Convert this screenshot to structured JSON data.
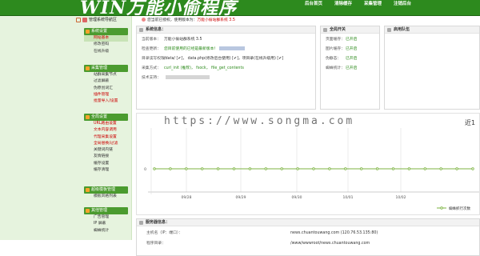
{
  "header": {
    "logo": "WIN万能小偷程序",
    "nav": [
      "后台首页",
      "清除缓存",
      "采集管理",
      "注销后台"
    ]
  },
  "sidebar": {
    "title": "管理系统导航区",
    "groups": [
      {
        "label": "系统设置",
        "items": [
          "网站基本",
          "修改密码",
          "在线升级"
        ]
      },
      {
        "label": "采集管理",
        "items": [
          "站群采集节点",
          "过滤屏蔽",
          "伪原创词汇",
          "插件管理",
          "批量导入/设置"
        ]
      },
      {
        "label": "全局设置",
        "items": [
          "URL路由设置",
          "文本内容调用",
          "代理采集设置",
          "全局替换/过滤",
          "关键词内链",
          "友情链接",
          "缓存设置",
          "缓存清理"
        ]
      },
      {
        "label": "超级模板管理",
        "items": [
          "模板风格列表"
        ]
      },
      {
        "label": "其他管理",
        "items": [
          "广告管理",
          "IP 屏蔽",
          "蜘蛛统计"
        ]
      }
    ]
  },
  "notice": {
    "text": "您当前已授权，使用版本为：",
    "version": "万能小偷站群系统 3.5"
  },
  "system_info": {
    "title": "系统信息：",
    "rows": [
      {
        "key": "当前版本：",
        "value": "万能小偷站群系统 3.5"
      },
      {
        "key": "检查更新：",
        "value": "您目前使用的已经是最新版本！"
      },
      {
        "key": "目录读写权限：",
        "value": "/data/ [✔]， data.php(修改后台使用) [✔]，项目录(在线升级用) [✔]"
      },
      {
        "key": "采集方式：",
        "value": "curl_init (推荐)， fsock， file_get_contents"
      },
      {
        "key": "技术支持：",
        "value": ""
      }
    ]
  },
  "global_switch": {
    "title": "全局开关",
    "rows": [
      {
        "key": "页面缓存：",
        "value": "已开启"
      },
      {
        "key": "图片缓存：",
        "value": "已开启"
      },
      {
        "key": "伪静态：",
        "value": "已开启"
      },
      {
        "key": "蜘蛛统计：",
        "value": "已开启"
      }
    ]
  },
  "proxy": {
    "title": "启用队伍"
  },
  "chart_data": {
    "type": "line",
    "title": "近1",
    "x": [
      "09/28",
      "09/29",
      "09/30",
      "10/01",
      "10/02"
    ],
    "series": [
      {
        "name": "蜘蛛抓行次数",
        "values": [
          0,
          0,
          0,
          0,
          0,
          0,
          0,
          0,
          0,
          0,
          0,
          0,
          0,
          0,
          0,
          0,
          0,
          0,
          0,
          0,
          0
        ]
      }
    ],
    "yticks": [
      "0"
    ],
    "grid": true,
    "legend": "bottom-right"
  },
  "server_info": {
    "title": "服务器信息：",
    "rows": [
      {
        "key": "主机名（IP：端口）：",
        "value": "news.chuantouwang.com  (120.76.53.135:80)"
      },
      {
        "key": "程序目录：",
        "value": "/www/wwwroot/news.chuantouwang.com"
      }
    ]
  },
  "watermark": "https://www.songma.com",
  "colors": {
    "brand_green": "#2d8a1e",
    "sidebar_bg": "#e6f3de",
    "link_red": "#c00",
    "ok_green": "#2b8a1a",
    "series": "#7cb342"
  }
}
